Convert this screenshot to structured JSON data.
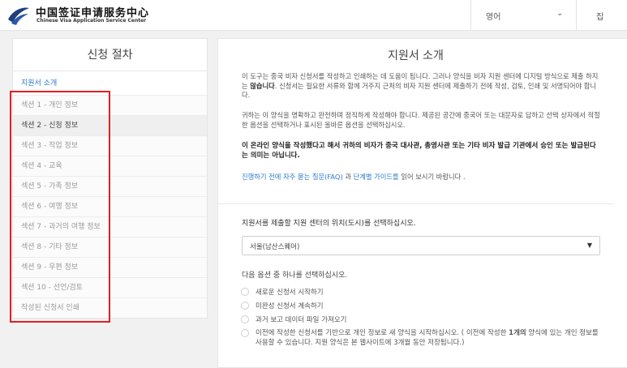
{
  "header": {
    "logo_icon": "visa-center-swoosh-logo",
    "logo_cn": "中国签证申请服务中心",
    "logo_en": "Chinese Visa Application Service Center",
    "language_label": "영어",
    "language_chevron": "chevron-down-icon",
    "home_label": "집"
  },
  "sidebar": {
    "title": "신청 절차",
    "items": [
      {
        "label": "지원서 소개"
      },
      {
        "label": "섹션 1 - 개인 정보"
      },
      {
        "label": "섹션 2 - 신청 정보"
      },
      {
        "label": "섹션 3 - 작업 정보"
      },
      {
        "label": "섹션 4 - 교육"
      },
      {
        "label": "섹션 5 - 가족 정보"
      },
      {
        "label": "섹션 6 - 여행 정보"
      },
      {
        "label": "섹션 7 - 과거의 여행 정보"
      },
      {
        "label": "섹션 8 - 기타 정보"
      },
      {
        "label": "섹션 9 - 우편 정보"
      },
      {
        "label": "섹션 10 - 선언/검토"
      },
      {
        "label": "작성된 신청서 인쇄"
      }
    ],
    "highlight_color": "#e21f26"
  },
  "main": {
    "title": "지원서 소개",
    "p1_a": "이 도구는 중국 비자 신청서를 작성하고 인쇄하는 데 도움이 됩니다. 그러나 양식을 비자 지원 센터에 디지털 방식으로 제출 하지는 ",
    "p1_b": "않습니다",
    "p1_c": ". 신청서는 필요한 서류와 함께 거주지 근처의 비자 지원 센터에 제출하기 전에 작성, 검토, 인쇄 및 서명되어야 합니다.",
    "p2": "귀하는 이 양식을 명확하고 완전하며 정직하게 작성해야 합니다. 제공된 공간에 중국어 또는 대문자로 답하고 선택 상자에서 적절한 옵션을 선택하거나 표시된 올바른 옵션을 선택하십시오.",
    "p3": "이 온라인 양식을 작성했다고 해서 귀하의 비자가 중국 대사관, 총영사관 또는 기타 비자 발급 기관에서 승인 또는 발급된다는 의미는 아닙니다.",
    "p4_link1": "진행하기 전에 자주 묻는 질문(FAQ)",
    "p4_mid": " 과 ",
    "p4_link2": "단계별 가이드를",
    "p4_end": " 읽어 보시기 바랍니다 .",
    "q_location": "지원서를 제출할 지원 센터의 위치(도시)를 선택하십시오.",
    "location_value": "서울(남산스퀘어)",
    "q_option": "다음 옵션 중 하나를 선택하십시오.",
    "opt1": "새로운 신청서 시작하기",
    "opt2": "미완성 신청서 계속하기",
    "opt3": "과거 보고 데이터 파일 가져오기",
    "opt4_a": "이전에 작성한 신청서를 기반으로 개인 정보로 새 양식을 시작하십시오. ( 이전에 작성한 ",
    "opt4_b": "1개의",
    "opt4_c": " 양식에 있는 개인 정보를 사용할 수 있습니다. 지원 양식은 본 웹사이트에 3개월 동안 저장됩니다.)",
    "link_color": "#2a7ad0"
  }
}
